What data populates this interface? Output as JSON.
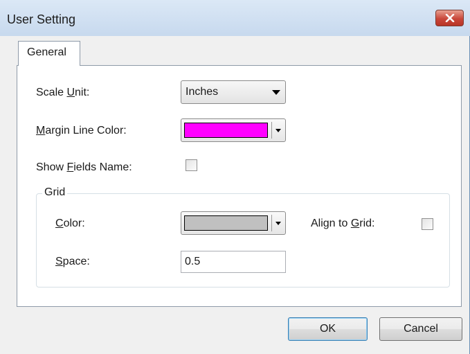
{
  "window": {
    "title": "User Setting"
  },
  "tabs": [
    {
      "label": "General"
    }
  ],
  "fields": {
    "scale_unit": {
      "label_pre": "Scale ",
      "label_key": "U",
      "label_post": "nit:",
      "value": "Inches"
    },
    "margin_line_color": {
      "label_pre": "",
      "label_key": "M",
      "label_post": "argin Line Color:",
      "color": "#ff00ff"
    },
    "show_fields_name": {
      "label_pre": "Show ",
      "label_key": "F",
      "label_post": "ields Name:",
      "checked": false
    }
  },
  "grid": {
    "group_label": "Grid",
    "color": {
      "label_pre": "",
      "label_key": "C",
      "label_post": "olor:",
      "color": "#c0c0c0"
    },
    "align_to_grid": {
      "label_pre": "Align to ",
      "label_key": "G",
      "label_post": "rid:",
      "checked": false
    },
    "space": {
      "label_pre": "",
      "label_key": "S",
      "label_post": "pace:",
      "value": "0.5"
    }
  },
  "buttons": {
    "ok": "OK",
    "cancel": "Cancel"
  },
  "icons": {
    "close": "close-icon",
    "dropdown": "chevron-down-icon"
  }
}
